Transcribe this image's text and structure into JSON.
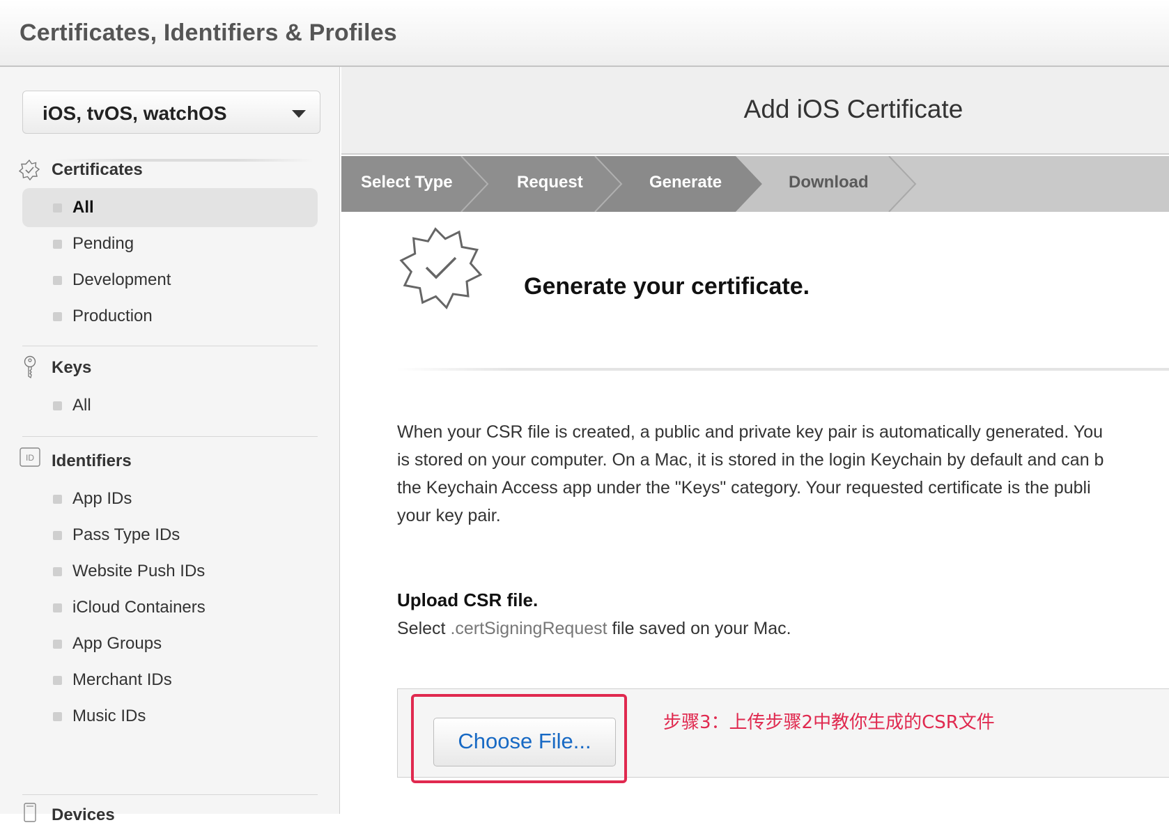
{
  "header": {
    "title": "Certificates, Identifiers & Profiles"
  },
  "sidebar": {
    "platform_select": "iOS, tvOS, watchOS",
    "sections": [
      {
        "title": "Certificates",
        "items": [
          "All",
          "Pending",
          "Development",
          "Production"
        ],
        "active": "All"
      },
      {
        "title": "Keys",
        "items": [
          "All"
        ]
      },
      {
        "title": "Identifiers",
        "icon_text": "ID",
        "items": [
          "App IDs",
          "Pass Type IDs",
          "Website Push IDs",
          "iCloud Containers",
          "App Groups",
          "Merchant IDs",
          "Music IDs"
        ]
      },
      {
        "title": "Devices"
      }
    ]
  },
  "main": {
    "title": "Add iOS Certificate",
    "steps": [
      {
        "label": "Select Type",
        "state": "done"
      },
      {
        "label": "Request",
        "state": "done"
      },
      {
        "label": "Generate",
        "state": "current"
      },
      {
        "label": "Download",
        "state": "pending"
      }
    ],
    "generate_title": "Generate your certificate.",
    "paragraph_lines": [
      "When your CSR file is created, a public and private key pair is automatically generated. You",
      "is stored on your computer. On a Mac, it is stored in the login Keychain by default and can b",
      "the Keychain Access app under the \"Keys\" category. Your requested certificate is the publi",
      "your key pair."
    ],
    "upload_title": "Upload CSR file.",
    "upload_hint_prefix": "Select",
    "upload_hint_ext": ".certSigningRequest",
    "upload_hint_suffix": "file saved on your Mac.",
    "choose_file_label": "Choose File...",
    "annotation": "步骤3：上传步骤2中教你生成的CSR文件"
  },
  "colors": {
    "step_done": "#8e8e8e",
    "step_current": "#8a8a8a",
    "step_pending": "#c4c4c4",
    "highlight": "#e0294f",
    "link_blue": "#1769c4"
  },
  "icons": [
    "caret-down-icon",
    "certificate-badge-icon",
    "key-icon",
    "id-icon",
    "device-icon",
    "certificate-check-icon"
  ]
}
